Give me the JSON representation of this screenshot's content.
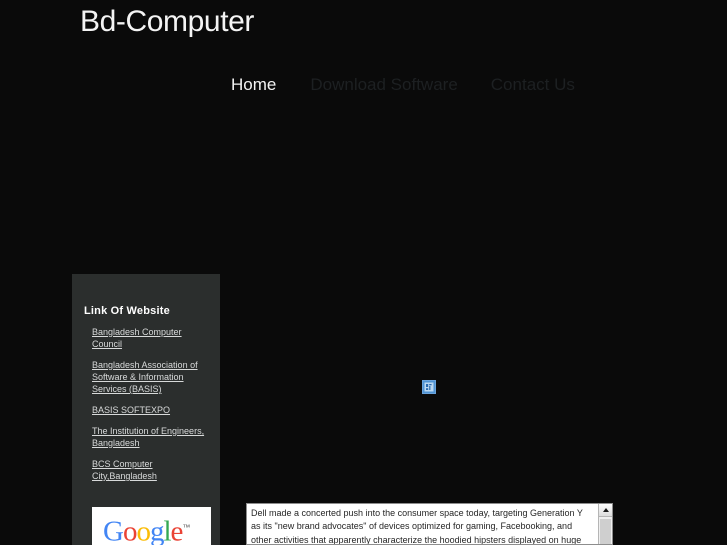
{
  "header": {
    "title": "Bd-Computer"
  },
  "nav": {
    "items": [
      {
        "label": "Home",
        "state": "active"
      },
      {
        "label": "Download Software",
        "state": "dim"
      },
      {
        "label": "Contact Us",
        "state": "dim"
      }
    ]
  },
  "sidebar": {
    "title": "Link Of Website",
    "links": [
      {
        "label": "Bangladesh Computer Council"
      },
      {
        "label": "Bangladesh Association of Software & Information Services (BASIS)"
      },
      {
        "label": "BASIS SOFTEXPO"
      },
      {
        "label": "The Institution of Engineers, Bangladesh"
      },
      {
        "label": "BCS Computer City,Bangladesh"
      }
    ],
    "google_badge": {
      "letters": [
        "G",
        "o",
        "o",
        "g",
        "l",
        "e"
      ],
      "trademark": "™"
    }
  },
  "main": {
    "broken_image_alt": "",
    "article": {
      "text": "Dell made a concerted push into the consumer space today, targeting Generation Y as its \"new brand advocates\" of devices optimized for gaming, Facebooking, and other activities that apparently characterize the hoodied hipsters displayed on huge screens"
    }
  },
  "colors": {
    "page_background": "#0a0a0a",
    "sidebar_background": "#2b2e2d",
    "title_text": "#f4f4f4",
    "nav_active": "#f2f2f2",
    "nav_dim": "#1d2022",
    "link_text": "#d8dada",
    "article_background": "#ffffff",
    "article_text": "#262626"
  }
}
